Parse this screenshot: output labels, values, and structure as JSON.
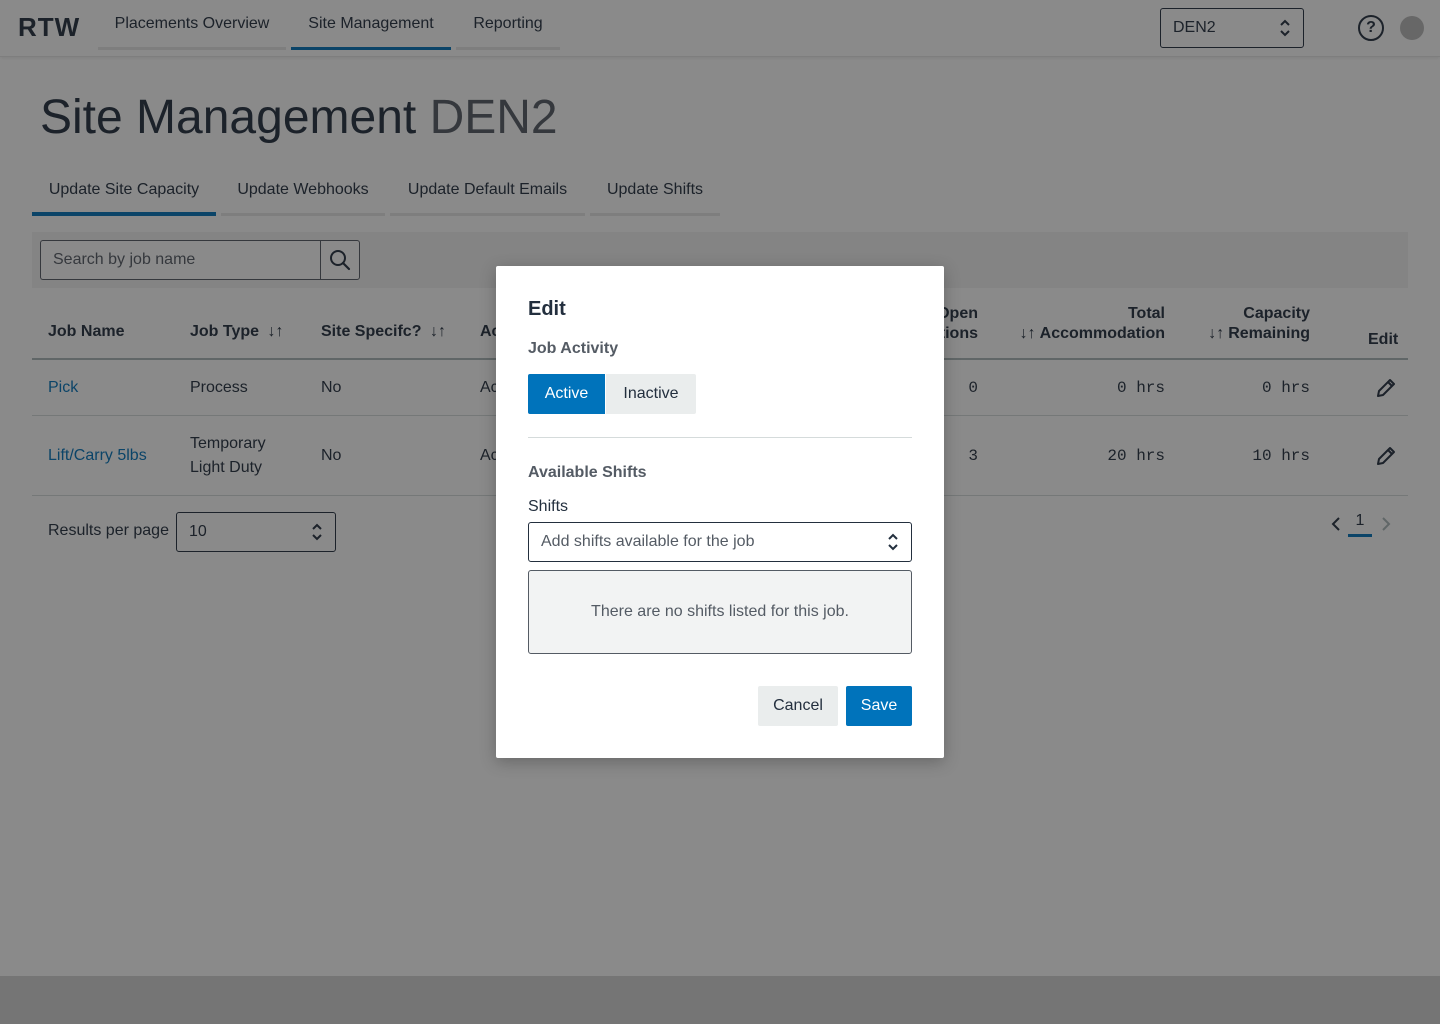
{
  "app": {
    "brand": "RTW"
  },
  "nav": {
    "tabs": [
      {
        "label": "Placements Overview",
        "active": false
      },
      {
        "label": "Site Management",
        "active": true
      },
      {
        "label": "Reporting",
        "active": false
      }
    ],
    "site_select": {
      "value": "DEN2"
    },
    "help_icon": "question-circle-icon",
    "avatar": "user-avatar"
  },
  "page": {
    "title": "Site Management",
    "site": "DEN2",
    "subtabs": [
      {
        "label": "Update Site Capacity",
        "active": true
      },
      {
        "label": "Update Webhooks",
        "active": false
      },
      {
        "label": "Update Default Emails",
        "active": false
      },
      {
        "label": "Update Shifts",
        "active": false
      }
    ],
    "search": {
      "placeholder": "Search by job name",
      "value": ""
    }
  },
  "table": {
    "columns": {
      "job_name": "Job Name",
      "job_type": "Job Type",
      "site_specific": "Site Specifc?",
      "activity_partial": "Ac",
      "open_positions_line1": "Open",
      "open_positions_line2": "tions",
      "total_line1": "Total",
      "total_line2": "Accommodation",
      "capacity_line1": "Capacity",
      "capacity_line2": "Remaining",
      "edit": "Edit"
    },
    "sort_icon": "↓↑",
    "rows": [
      {
        "job_name": "Pick",
        "job_type_line1": "Process",
        "job_type_line2": "",
        "site_specific": "No",
        "activity": "Ac",
        "open": "0",
        "total": "0 hrs",
        "capacity": "0 hrs"
      },
      {
        "job_name": "Lift/Carry 5lbs",
        "job_type_line1": "Temporary",
        "job_type_line2": "Light Duty",
        "site_specific": "No",
        "activity": "Ac",
        "open": "3",
        "total": "20 hrs",
        "capacity": "10 hrs"
      }
    ]
  },
  "pagination": {
    "results_per_page_label": "Results per page",
    "results_per_page": "10",
    "current_page": "1"
  },
  "modal": {
    "title": "Edit",
    "job_activity_label": "Job Activity",
    "active_label": "Active",
    "inactive_label": "Inactive",
    "selected_activity": "Active",
    "available_shifts_label": "Available Shifts",
    "shifts_field_label": "Shifts",
    "shifts_placeholder": "Add shifts available for the job",
    "empty_message": "There are no shifts listed for this job.",
    "cancel_label": "Cancel",
    "save_label": "Save"
  },
  "colors": {
    "accent": "#0073bb",
    "text": "#232f3e",
    "muted": "#545b64"
  }
}
